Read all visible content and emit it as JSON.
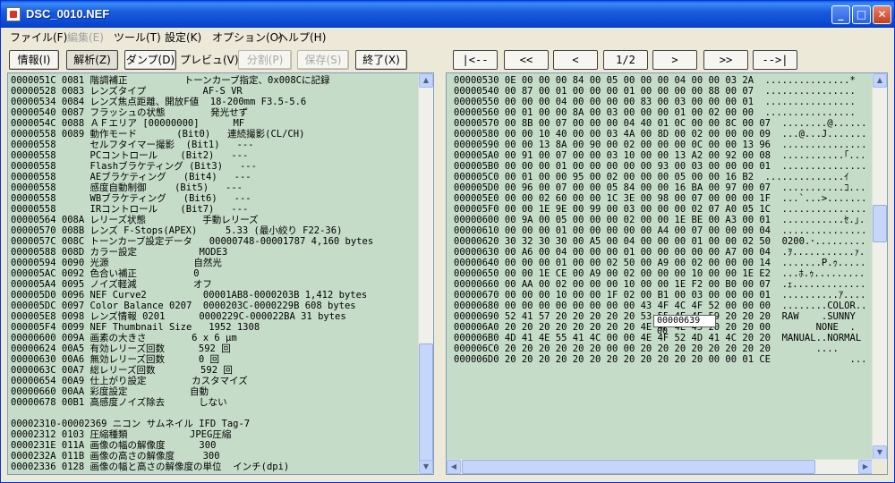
{
  "window": {
    "title": "DSC_0010.NEF"
  },
  "titlebar_buttons": {
    "minimize": "_",
    "maximize": "□",
    "close": "✕"
  },
  "menu": [
    {
      "label": "ファイル(F)",
      "enabled": true
    },
    {
      "label": "編集(E)",
      "enabled": false
    },
    {
      "label": "ツール(T)",
      "enabled": true
    },
    {
      "label": "設定(K)",
      "enabled": true
    },
    {
      "label": "オプション(O)",
      "enabled": true
    },
    {
      "label": "ヘルプ(H)",
      "enabled": true
    }
  ],
  "toolbar": {
    "info": "情報(I)",
    "analyze": "解析(Z)",
    "dump": "ダンプ(D)",
    "preview": "プレビュ(V)",
    "split": "分割(P)",
    "save": "保存(S)",
    "exit": "終了(X)"
  },
  "nav": {
    "first": "|<--",
    "prev_page": "<<",
    "prev": "<",
    "page": "1/2",
    "next": ">",
    "next_page": ">>",
    "last": "-->|"
  },
  "left_lines": [
    "0000051C 0081 階調補正          トーンカーブ指定、0x008Cに記録",
    "00000528 0083 レンズタイプ          AF-S VR",
    "00000534 0084 レンズ焦点距離、開放F値  18-200mm F3.5-5.6",
    "00000540 0087 フラッシュの状態        発光せず",
    "0000054C 0088 ＡＦエリア [00000000]      MF",
    "00000558 0089 動作モード       (Bit0)   連続撮影(CL/CH)",
    "00000558      セルフタイマー撮影  (Bit1)   ---",
    "00000558      PCコントロール    (Bit2)   ---",
    "00000558      Flashブラケティング (Bit3)   ---",
    "00000558      AEブラケティング   (Bit4)   ---",
    "00000558      感度自動制御     (Bit5)   ---",
    "00000558      WBブラケティング   (Bit6)   ---",
    "00000558      IRコントロール    (Bit7)   ---",
    "00000564 008A レリーズ状態          手動レリーズ",
    "00000570 008B レンズ F-Stops(APEX)     5.33 (最小絞り F22-36)",
    "0000057C 008C トーンカーブ設定データ   00000748-00001787 4,160 bytes",
    "00000588 008D カラー設定           MODE3",
    "00000594 0090 光源               自然光",
    "000005AC 0092 色合い補正          0",
    "000005A4 0095 ノイズ軽減          オフ",
    "000005D0 0096 NEF Curve2          00001AB8-0000203B 1,412 bytes",
    "000005DC 0097 Color Balance 0207  0000203C-0000229B 608 bytes",
    "000005E8 0098 レンズ情報 0201      0000229C-000022BA 31 bytes",
    "000005F4 0099 NEF Thumbnail Size   1952 1308",
    "00000600 009A 画素の大きさ        6 x 6 μm",
    "00000624 00A5 有効レリーズ回数      592 回",
    "00000630 00A6 無効レリーズ回数      0 回",
    "0000063C 00A7 総レリーズ回数        592 回",
    "00000654 00A9 仕上がり設定        カスタマイズ",
    "00000660 00AA 彩度設定           自動",
    "00000678 00B1 高感度ノイズ除去      しない",
    "",
    "00002310-00002369 ニコン サムネイル IFD Tag-7",
    "00002312 0103 圧縮種類           JPEG圧縮",
    "0000231E 011A 画像の幅の解像度      300",
    "0000232A 011B 画像の高さの解像度     300",
    "00002336 0128 画像の幅と高さの解像度の単位  インチ(dpi)"
  ],
  "right_lines": [
    "00000530 0E 00 00 00 84 00 05 00 00 00 04 00 00 03 2A  ...............*",
    "00000540 00 87 00 01 00 00 00 01 00 00 00 00 88 00 07  ................",
    "00000550 00 00 00 04 00 00 00 00 83 00 03 00 00 00 01  ................",
    "00000560 00 01 00 00 8A 00 03 00 00 00 01 00 02 00 00  ................",
    "00000570 00 8B 00 07 00 00 00 04 40 01 0C 00 00 8C 00 07  ........@.......",
    "00000580 00 00 10 40 00 00 03 4A 00 8D 00 02 00 00 00 09  ...@...J........",
    "00000590 00 00 13 8A 00 90 00 02 00 00 00 0C 00 00 13 96  ................",
    "000005A0 00 91 00 07 00 00 03 10 00 00 13 A2 00 92 00 08  ...........｢....",
    "000005B0 00 00 00 01 00 00 00 00 00 93 00 03 00 00 00 01  ................",
    "000005C0 00 01 00 00 95 00 02 00 00 00 05 00 00 16 B2  ..............ｲ",
    "000005D0 00 96 00 07 00 00 05 84 00 00 16 BA 00 97 00 07  ...........ｺ....",
    "000005E0 00 00 02 60 00 00 1C 3E 00 98 00 07 00 00 00 1F  ...`...>........",
    "000005F0 00 00 1E 9E 00 99 00 03 00 00 00 02 07 A0 05 1C  ................",
    "00000600 00 9A 00 05 00 00 00 02 00 00 1E BE 00 A3 00 01  ...........ｾ.｣..",
    "00000610 00 00 00 01 00 00 00 00 00 A4 00 07 00 00 00 04  ................",
    "00000620 30 32 30 30 00 A5 00 04 00 00 00 01 00 00 02 50  0200.･.........P",
    "00000630 00 A6 00 04 00 00 00 01 00 00 00 00 00 A7 00 04  .ｦ...........ｧ..",
    "00000640 00 00 00 01 00 00 02 50 00 A9 00 02 00 00 00 14  .......P.ｩ......",
    "00000650 00 00 1E CE 00 A9 00 02 00 00 00 10 00 00 1E E2  ...ﾎ.ｩ.........",
    "00000660 00 AA 00 02 00 00 00 10 00 00 1E F2 00 B0 00 07  .ｪ..............",
    "00000670 00 00 00 10 00 00 1F 02 00 B1 00 03 00 00 00 01  ..........ｱ.....",
    "00000680 00 00 00 00 00 00 00 00 43 4F 4C 4F 52 00 00 00  ........COLOR...",
    "00000690 52 41 57 20 20 20 20 20 53 55 4E 4E 59 20 20 20  RAW    .SUNNY",
    "000006A0 20 20 20 20 20 20 20 20 4E 4F 4E 45 20 20 20 00        NONE  .",
    "000006B0 4D 41 4E 55 41 4C 00 00 4E 4F 52 4D 41 4C 20 20  MANUAL..NORMAL",
    "000006C0 20 20 20 20 20 20 00 00 20 20 20 20 20 20 20 20        ....",
    "000006D0 20 20 20 20 20 20 20 20 20 20 20 20 00 00 01 CE              ....ﾎ"
  ],
  "tooltip": "00000639 00"
}
